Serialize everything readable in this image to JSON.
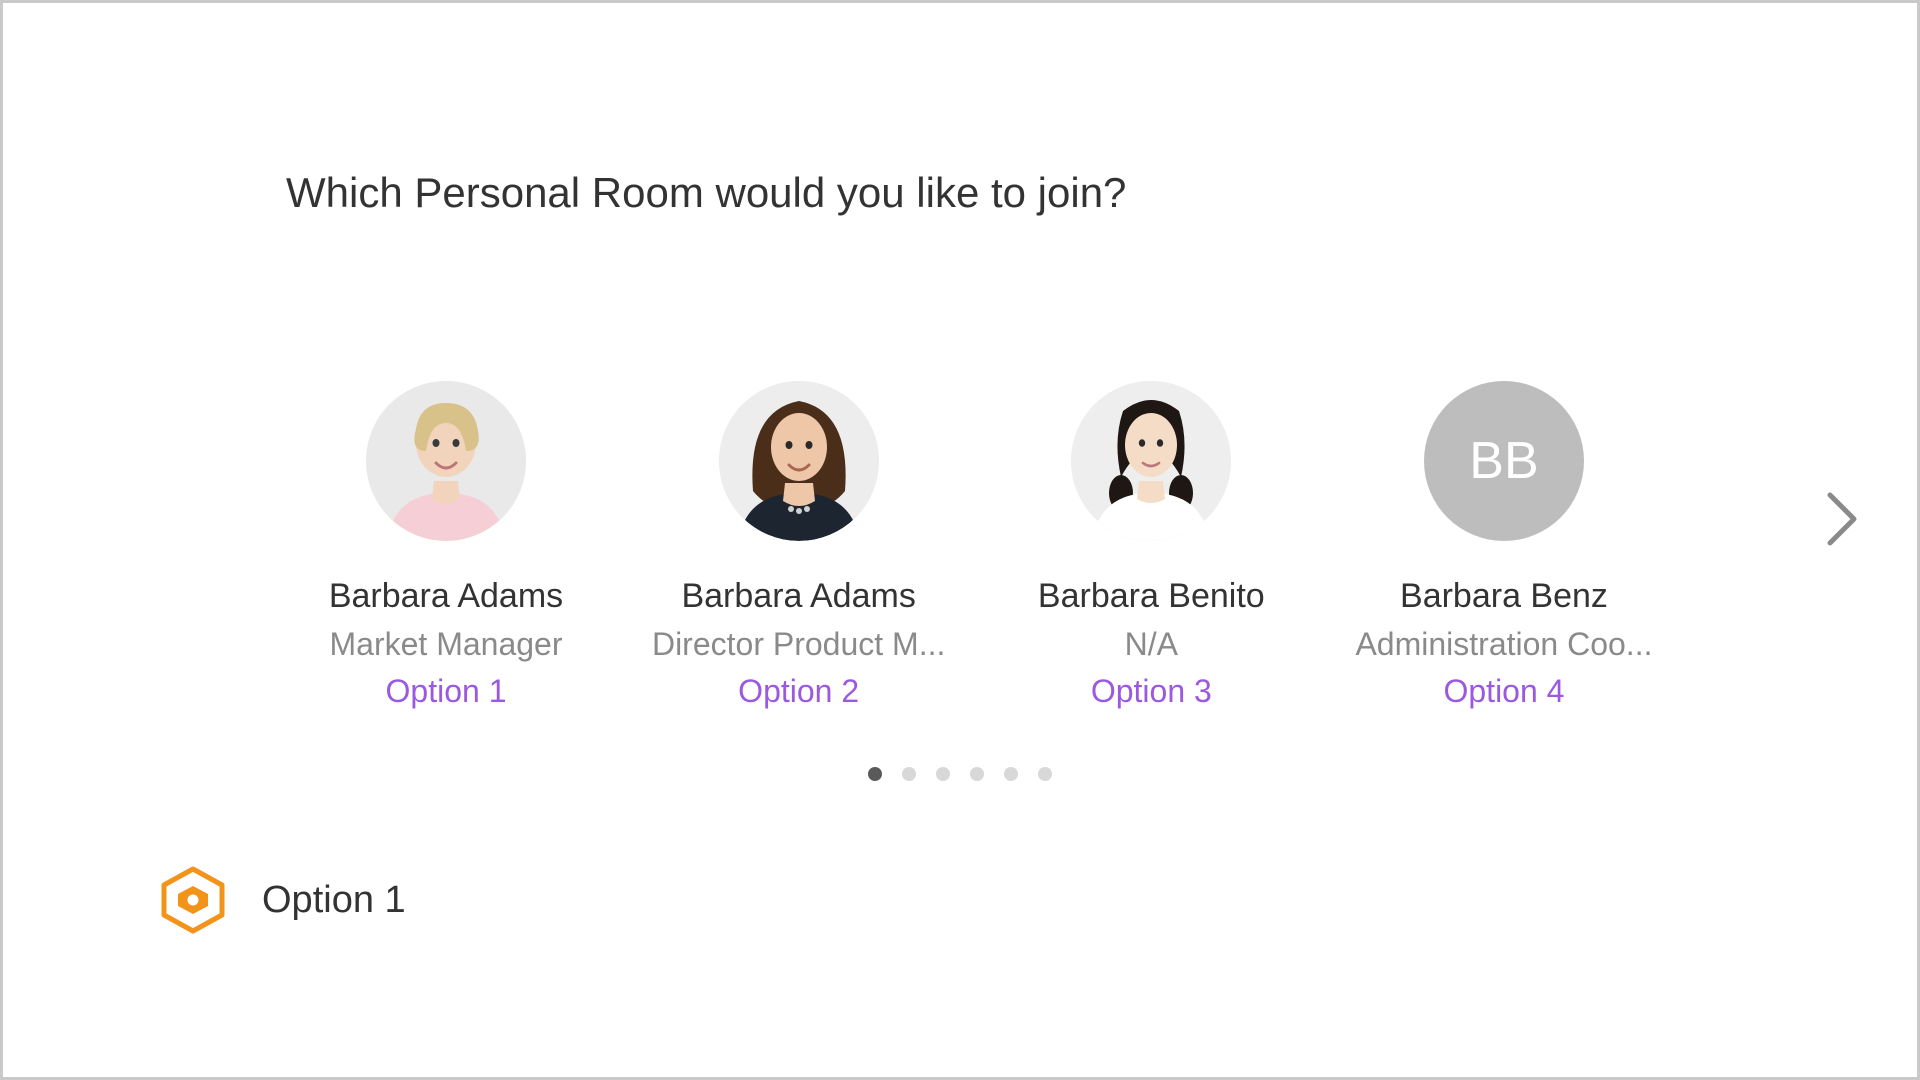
{
  "heading": "Which Personal Room would you like to join?",
  "people": [
    {
      "name": "Barbara Adams",
      "title": "Market Manager",
      "option": "Option 1",
      "avatar_type": "photo",
      "initials": ""
    },
    {
      "name": "Barbara Adams",
      "title": "Director Product M...",
      "option": "Option 2",
      "avatar_type": "photo",
      "initials": ""
    },
    {
      "name": "Barbara Benito",
      "title": "N/A",
      "option": "Option 3",
      "avatar_type": "photo",
      "initials": ""
    },
    {
      "name": "Barbara Benz",
      "title": "Administration Coo...",
      "option": "Option 4",
      "avatar_type": "initials",
      "initials": "BB"
    }
  ],
  "pagination": {
    "total": 6,
    "active": 0
  },
  "footer": {
    "label": "Option 1"
  },
  "colors": {
    "accent": "#9b59e0",
    "brand": "#f2941a"
  }
}
